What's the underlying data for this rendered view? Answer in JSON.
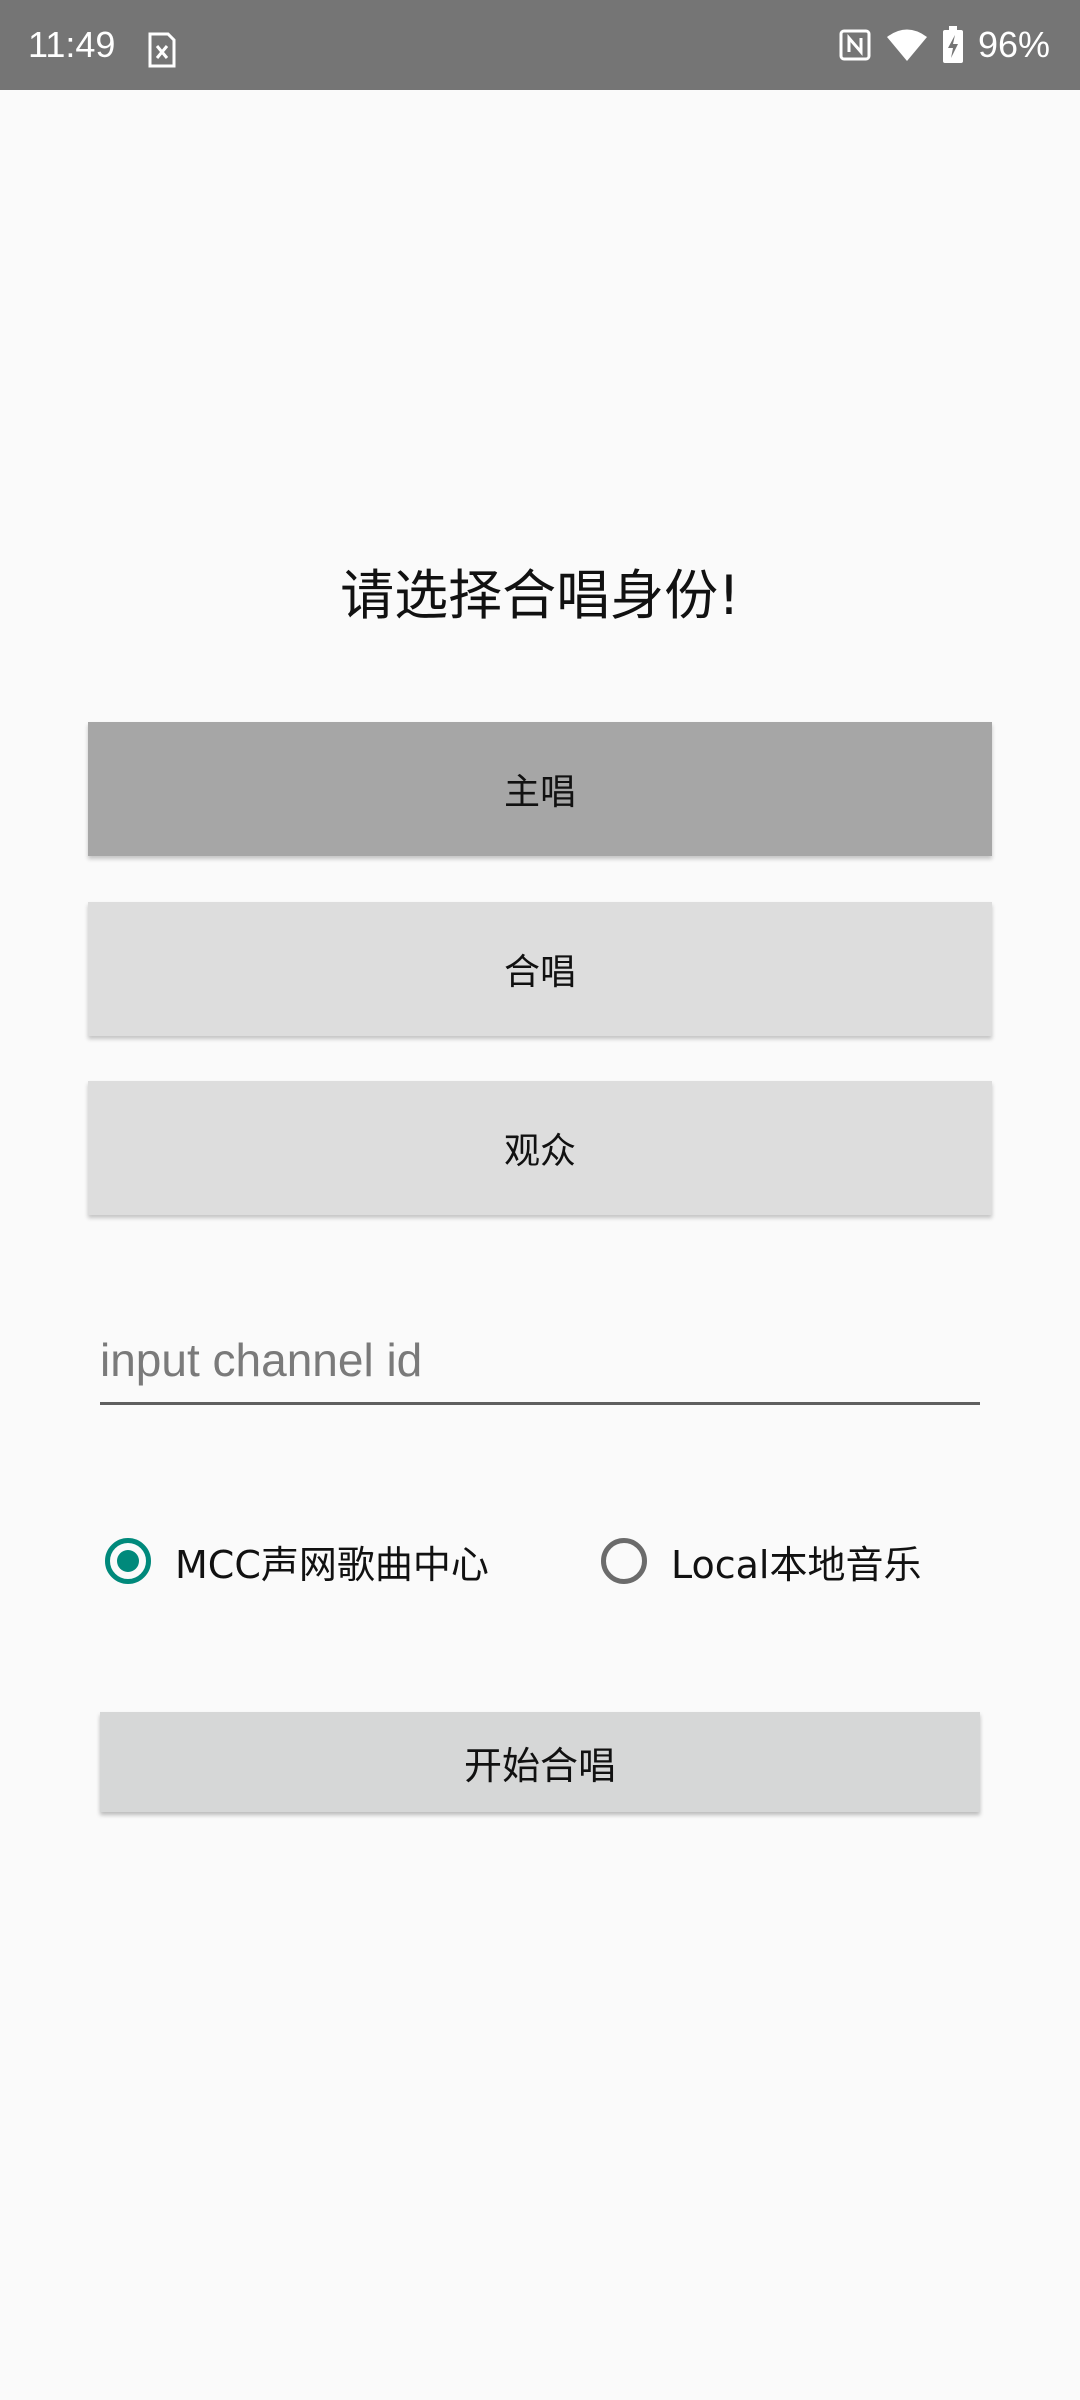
{
  "status_bar": {
    "time": "11:49",
    "battery": "96%",
    "icons": [
      "sim-card-error-icon",
      "nfc-icon",
      "wifi-icon",
      "battery-charging-icon"
    ]
  },
  "page": {
    "title": "请选择合唱身份!"
  },
  "roles": [
    {
      "label": "主唱",
      "selected": true
    },
    {
      "label": "合唱",
      "selected": false
    },
    {
      "label": "观众",
      "selected": false
    }
  ],
  "channel_input": {
    "value": "",
    "placeholder": "input channel id"
  },
  "music_source": {
    "options": [
      {
        "label": "MCC声网歌曲中心",
        "checked": true
      },
      {
        "label": "Local本地音乐",
        "checked": false
      }
    ]
  },
  "start_button": {
    "label": "开始合唱"
  },
  "colors": {
    "status_bar": "#757575",
    "background": "#fafafa",
    "selected_role": "#a6a6a6",
    "role_button": "#dddddd",
    "accent": "#00897b",
    "start_button": "#d6d7d7"
  }
}
